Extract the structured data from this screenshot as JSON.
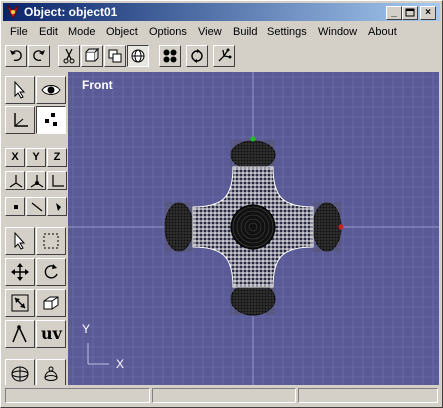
{
  "window": {
    "title": "Object: object01"
  },
  "menu": [
    "File",
    "Edit",
    "Mode",
    "Object",
    "Options",
    "View",
    "Build",
    "Settings",
    "Window",
    "About"
  ],
  "toolbar": {
    "icons": [
      "undo-icon",
      "redo-icon",
      "cut-icon",
      "copy-icon",
      "paste-icon",
      "sphere-icon",
      "four-dots-icon",
      "rotate-icon",
      "sparkle-icon"
    ]
  },
  "tools": {
    "axis_x": "X",
    "axis_y": "Y",
    "axis_z": "Z",
    "uv_label": "uv"
  },
  "viewport": {
    "label": "Front",
    "axis_y": "Y",
    "axis_x": "X",
    "background": "#5a5a96",
    "grid_color": "#6c6cac",
    "axis_color": "#8e8ec4"
  }
}
